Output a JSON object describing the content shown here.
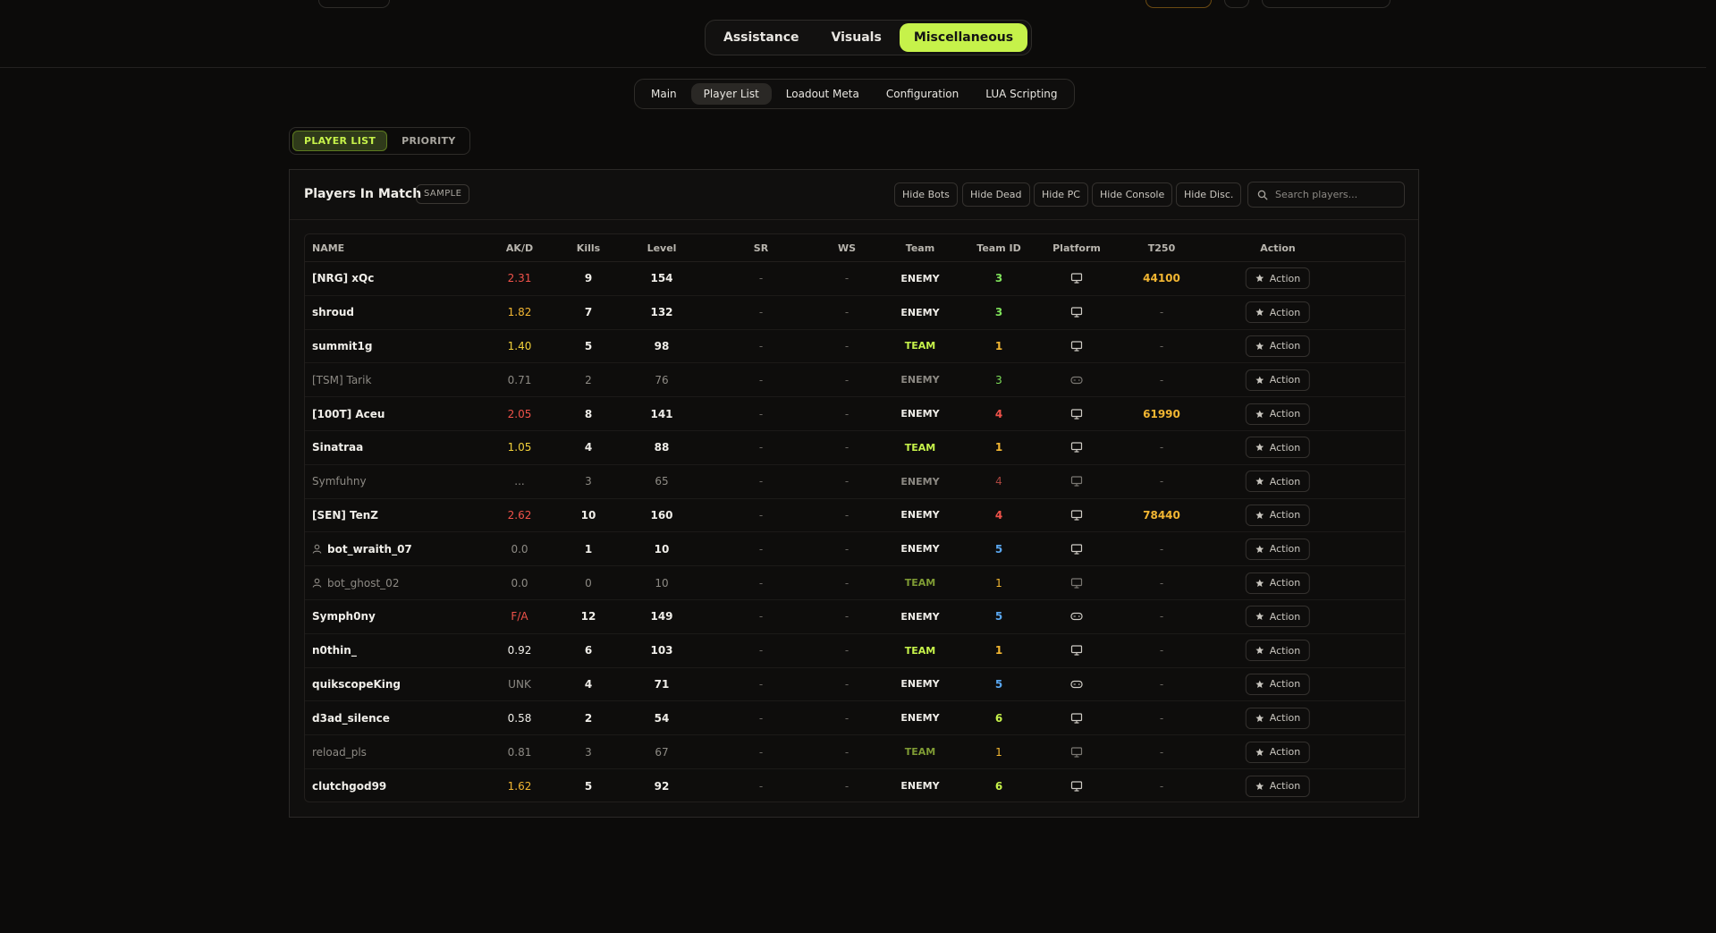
{
  "main_tabs": [
    "Assistance",
    "Visuals",
    "Miscellaneous"
  ],
  "main_tab_active": "Miscellaneous",
  "sub_tabs": [
    "Main",
    "Player List",
    "Loadout Meta",
    "Configuration",
    "LUA Scripting"
  ],
  "sub_tab_active": "Player List",
  "list_toggle": [
    "PLAYER LIST",
    "PRIORITY"
  ],
  "panel": {
    "title": "Players In Match",
    "badge": "SAMPLE",
    "filters": [
      "Hide Bots",
      "Hide Dead",
      "Hide PC",
      "Hide Console",
      "Hide Disc."
    ],
    "search_placeholder": "Search players..."
  },
  "columns": [
    "NAME",
    "AK/D",
    "Kills",
    "Level",
    "SR",
    "WS",
    "Team",
    "Team ID",
    "Platform",
    "T250",
    "Action"
  ],
  "action_label": "Action",
  "colors": {
    "accent": "#c6f24a",
    "enemy_id": "#7ee05a",
    "red": "#f0524a",
    "amber": "#f2b632",
    "blue": "#5aa7f0"
  },
  "rows": [
    {
      "name": "[NRG] xQc",
      "bot": false,
      "dim": false,
      "akd": "2.31",
      "akd_color": "red",
      "kills": "9",
      "level": "154",
      "sr": "-",
      "ws": "-",
      "team": "ENEMY",
      "team_id": "3",
      "id_color": "green",
      "platform": "pc",
      "t250": "44100"
    },
    {
      "name": "shroud",
      "bot": false,
      "dim": false,
      "akd": "1.82",
      "akd_color": "amber",
      "kills": "7",
      "level": "132",
      "sr": "-",
      "ws": "-",
      "team": "ENEMY",
      "team_id": "3",
      "id_color": "green",
      "platform": "pc",
      "t250": "-"
    },
    {
      "name": "summit1g",
      "bot": false,
      "dim": false,
      "akd": "1.40",
      "akd_color": "yellow",
      "kills": "5",
      "level": "98",
      "sr": "-",
      "ws": "-",
      "team": "TEAM",
      "team_id": "1",
      "id_color": "amber",
      "platform": "pc",
      "t250": "-"
    },
    {
      "name": "[TSM] Tarik",
      "bot": false,
      "dim": true,
      "akd": "0.71",
      "akd_color": "dim",
      "kills": "2",
      "level": "76",
      "sr": "-",
      "ws": "-",
      "team": "ENEMY",
      "team_id": "3",
      "id_color": "green",
      "platform": "console",
      "t250": "-"
    },
    {
      "name": "[100T] Aceu",
      "bot": false,
      "dim": false,
      "akd": "2.05",
      "akd_color": "red",
      "kills": "8",
      "level": "141",
      "sr": "-",
      "ws": "-",
      "team": "ENEMY",
      "team_id": "4",
      "id_color": "red",
      "platform": "pc",
      "t250": "61990"
    },
    {
      "name": "Sinatraa",
      "bot": false,
      "dim": false,
      "akd": "1.05",
      "akd_color": "yellow",
      "kills": "4",
      "level": "88",
      "sr": "-",
      "ws": "-",
      "team": "TEAM",
      "team_id": "1",
      "id_color": "amber",
      "platform": "pc",
      "t250": "-"
    },
    {
      "name": "Symfuhny",
      "bot": false,
      "dim": true,
      "akd": "...",
      "akd_color": "dim",
      "kills": "3",
      "level": "65",
      "sr": "-",
      "ws": "-",
      "team": "ENEMY",
      "team_id": "4",
      "id_color": "red",
      "platform": "pc",
      "t250": "-"
    },
    {
      "name": "[SEN] TenZ",
      "bot": false,
      "dim": false,
      "akd": "2.62",
      "akd_color": "red",
      "kills": "10",
      "level": "160",
      "sr": "-",
      "ws": "-",
      "team": "ENEMY",
      "team_id": "4",
      "id_color": "red",
      "platform": "pc",
      "t250": "78440"
    },
    {
      "name": "bot_wraith_07",
      "bot": true,
      "dim": false,
      "akd": "0.0",
      "akd_color": "dim",
      "kills": "1",
      "level": "10",
      "sr": "-",
      "ws": "-",
      "team": "ENEMY",
      "team_id": "5",
      "id_color": "blue",
      "platform": "pc",
      "t250": "-"
    },
    {
      "name": "bot_ghost_02",
      "bot": true,
      "dim": true,
      "akd": "0.0",
      "akd_color": "dim",
      "kills": "0",
      "level": "10",
      "sr": "-",
      "ws": "-",
      "team": "TEAM",
      "team_id": "1",
      "id_color": "amber",
      "platform": "pc",
      "t250": "-"
    },
    {
      "name": "Symph0ny",
      "bot": false,
      "dim": false,
      "akd": "F/A",
      "akd_color": "red",
      "kills": "12",
      "level": "149",
      "sr": "-",
      "ws": "-",
      "team": "ENEMY",
      "team_id": "5",
      "id_color": "blue",
      "platform": "console",
      "t250": "-"
    },
    {
      "name": "n0thin_",
      "bot": false,
      "dim": false,
      "akd": "0.92",
      "akd_color": "white",
      "kills": "6",
      "level": "103",
      "sr": "-",
      "ws": "-",
      "team": "TEAM",
      "team_id": "1",
      "id_color": "amber",
      "platform": "pc",
      "t250": "-"
    },
    {
      "name": "quikscopeKing",
      "bot": false,
      "dim": false,
      "akd": "UNK",
      "akd_color": "dim",
      "kills": "4",
      "level": "71",
      "sr": "-",
      "ws": "-",
      "team": "ENEMY",
      "team_id": "5",
      "id_color": "blue",
      "platform": "console",
      "t250": "-"
    },
    {
      "name": "d3ad_silence",
      "bot": false,
      "dim": false,
      "akd": "0.58",
      "akd_color": "white",
      "kills": "2",
      "level": "54",
      "sr": "-",
      "ws": "-",
      "team": "ENEMY",
      "team_id": "6",
      "id_color": "lime",
      "platform": "pc",
      "t250": "-"
    },
    {
      "name": "reload_pls",
      "bot": false,
      "dim": true,
      "akd": "0.81",
      "akd_color": "dim",
      "kills": "3",
      "level": "67",
      "sr": "-",
      "ws": "-",
      "team": "TEAM",
      "team_id": "1",
      "id_color": "amber",
      "platform": "pc",
      "t250": "-"
    },
    {
      "name": "clutchgod99",
      "bot": false,
      "dim": false,
      "akd": "1.62",
      "akd_color": "amber",
      "kills": "5",
      "level": "92",
      "sr": "-",
      "ws": "-",
      "team": "ENEMY",
      "team_id": "6",
      "id_color": "lime",
      "platform": "pc",
      "t250": "-"
    }
  ]
}
